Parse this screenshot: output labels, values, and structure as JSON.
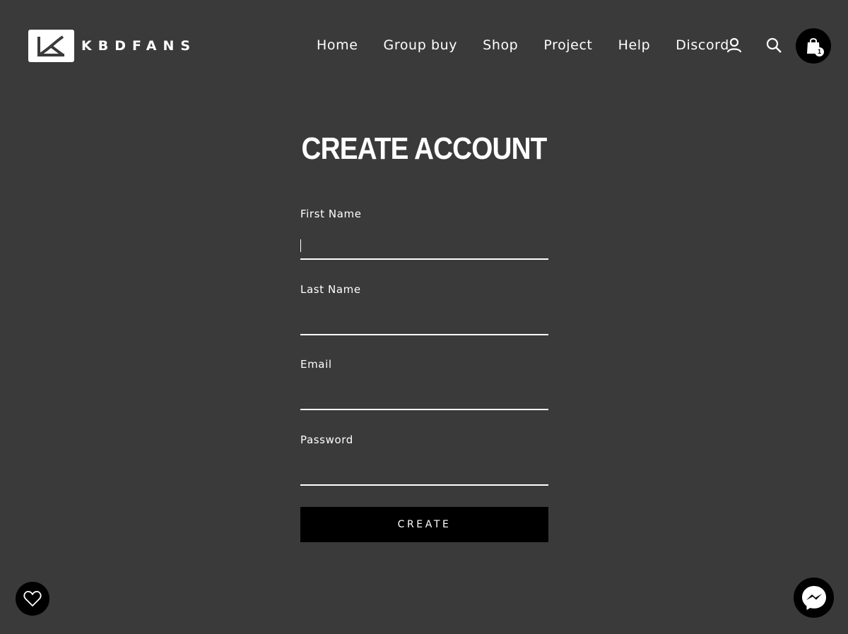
{
  "header": {
    "logo_text": "KBDFANS",
    "nav": [
      "Home",
      "Group buy",
      "Shop",
      "Project",
      "Help",
      "Discord"
    ],
    "icons": {
      "account": "account-icon",
      "search": "search-icon",
      "cart": "shopping-bag-icon"
    },
    "cart_count": "1"
  },
  "form": {
    "title": "CREATE ACCOUNT",
    "fields": [
      {
        "label": "First Name",
        "value": ""
      },
      {
        "label": "Last Name",
        "value": ""
      },
      {
        "label": "Email",
        "value": ""
      },
      {
        "label": "Password",
        "value": ""
      }
    ],
    "submit_label": "CREATE"
  },
  "widgets": {
    "wishlist": "heart-icon",
    "messenger": "messenger-icon"
  },
  "colors": {
    "background": "#3a3a3b",
    "text": "#ffffff",
    "button": "#000000"
  }
}
